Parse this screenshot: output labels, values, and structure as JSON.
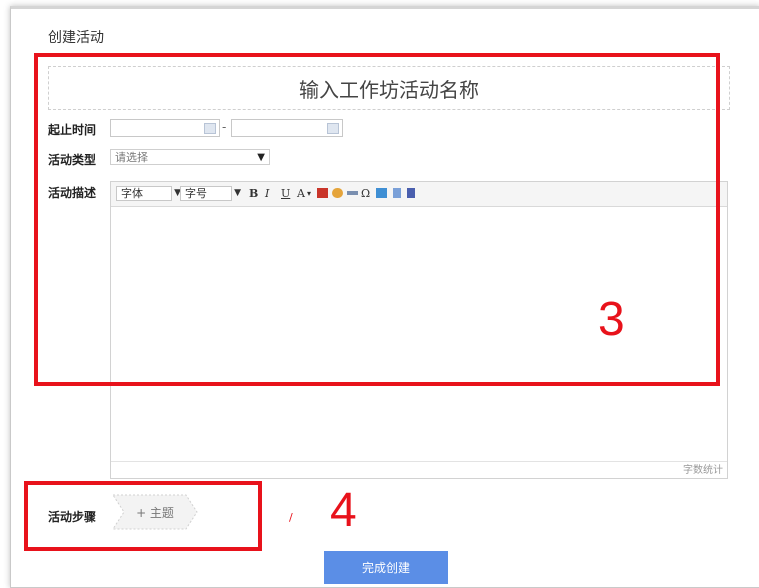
{
  "page_title": "创建活动",
  "title_placeholder": "输入工作坊活动名称",
  "labels": {
    "start_end_time": "起止时间",
    "activity_type": "活动类型",
    "activity_desc": "活动描述",
    "activity_steps": "活动步骤"
  },
  "date_separator": "-",
  "activity_type_select": {
    "value": "请选择"
  },
  "editor": {
    "font_family": "字体",
    "font_size": "字号",
    "bold": "B",
    "italic": "I",
    "underline": "U",
    "font_color": "A",
    "omega": "Ω",
    "word_count": "字数统计"
  },
  "steps": {
    "add_topic": "+ 主题"
  },
  "submit_label": "完成创建",
  "annotations": {
    "box3": "3",
    "box4": "4",
    "small_mark": "/"
  },
  "colors": {
    "annotation_red": "#e8121b",
    "primary_button": "#5b8ee6"
  },
  "icons": [
    "calendar-icon",
    "chevron-down-icon",
    "image-icon",
    "emoticon-icon",
    "link-icon",
    "attachment-icon",
    "video-icon"
  ]
}
